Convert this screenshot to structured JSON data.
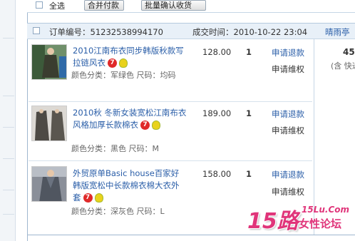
{
  "toolbar": {
    "select_all": "全选",
    "merge_pay": "合并付款",
    "batch_confirm": "批量确认收货"
  },
  "order": {
    "number_label": "订单编号：51232538994170",
    "deal_time": "成交时间：2010-10-22 23:04",
    "seller": "晴雨亭",
    "total": "45",
    "total_note": "(含 快递"
  },
  "items": [
    {
      "title": "2010江南布衣同步韩版秋款写拉链风衣",
      "attr": "颜色分类：军绿色    尺码：均码",
      "price": "128.00",
      "qty": "1",
      "action1": "申请退款",
      "action2": "申请维权"
    },
    {
      "title": "2010秋 冬新女装宽松江南布衣风格加厚长款棉衣",
      "attr": "颜色分类：黑色    尺码：M",
      "price": "189.00",
      "qty": "1",
      "action1": "申请退款",
      "action2": "申请维权"
    },
    {
      "title": "外贸原单Basic house百家好韩版宽松中长款棉衣棉大衣外套",
      "attr": "颜色分类：深灰色    尺码：L",
      "price": "158.00",
      "qty": "1",
      "action1": "申请退款",
      "action2": "申请维权"
    }
  ],
  "icons": {
    "promo": "7",
    "bulb": "bulb-icon"
  },
  "watermark": {
    "brand": "15路",
    "url": "15Lu.Com",
    "slogan": "女性论坛"
  },
  "colors": {
    "link": "#2a5ea8",
    "header_bg": "#e8f0f8",
    "watermark": "#e0357a"
  }
}
